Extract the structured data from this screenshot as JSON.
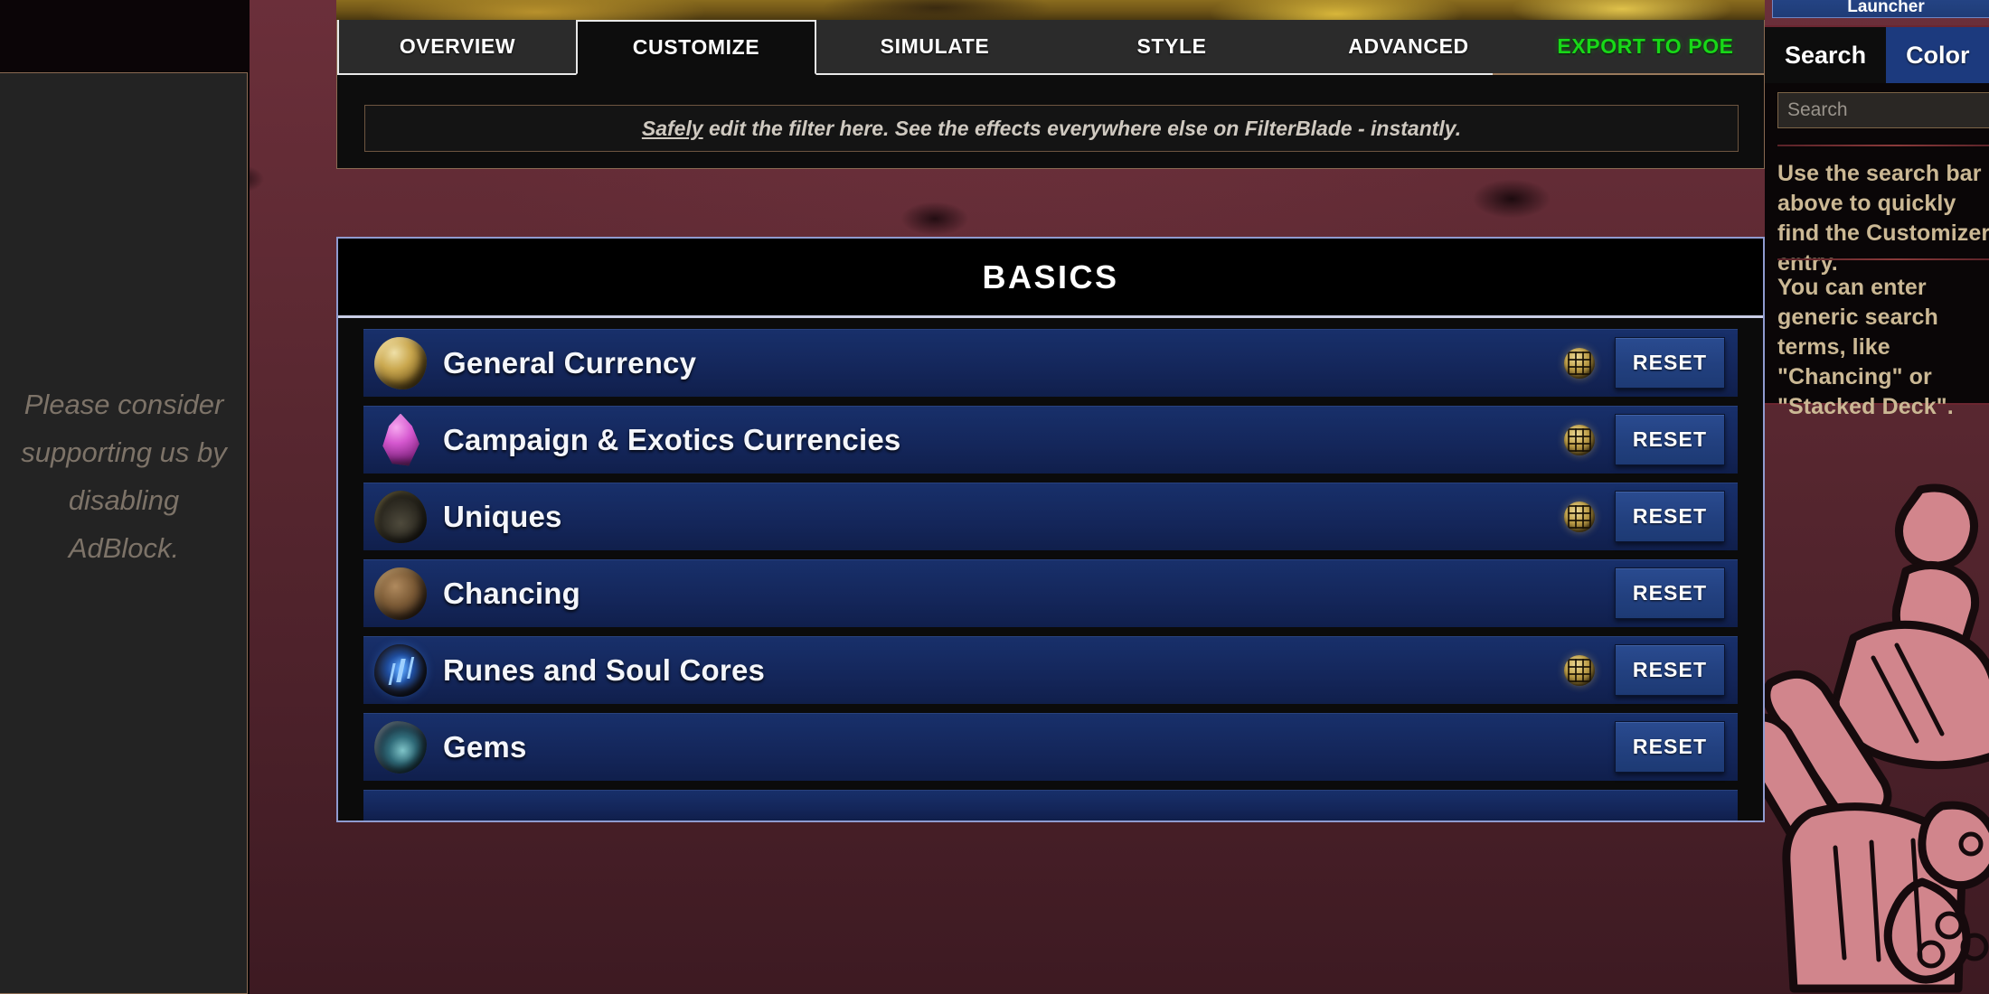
{
  "left_rail": {
    "ad_message": "Please consider supporting us by disabling AdBlock."
  },
  "tabs": [
    {
      "id": "overview",
      "label": "OVERVIEW",
      "active": false
    },
    {
      "id": "customize",
      "label": "CUSTOMIZE",
      "active": true
    },
    {
      "id": "simulate",
      "label": "SIMULATE",
      "active": false
    },
    {
      "id": "style",
      "label": "STYLE",
      "active": false
    },
    {
      "id": "advanced",
      "label": "ADVANCED",
      "active": false
    },
    {
      "id": "export",
      "label": "EXPORT TO POE",
      "active": false
    }
  ],
  "notice": {
    "emphasis": "Safely",
    "rest": " edit the filter here. See the effects everywhere else on FilterBlade - instantly."
  },
  "section": {
    "title": "BASICS",
    "reset_label": "RESET",
    "rows": [
      {
        "label": "General Currency",
        "icon": "currency-shard-icon",
        "icon_style": "ico-gold",
        "has_grid_badge": true
      },
      {
        "label": "Campaign & Exotics Currencies",
        "icon": "magenta-crystal-icon",
        "icon_style": "ico-magenta",
        "has_grid_badge": true
      },
      {
        "label": "Uniques",
        "icon": "beast-head-icon",
        "icon_style": "ico-beast",
        "has_grid_badge": true
      },
      {
        "label": "Chancing",
        "icon": "amulet-icon",
        "icon_style": "ico-amulet",
        "has_grid_badge": false
      },
      {
        "label": "Runes and Soul Cores",
        "icon": "rune-stone-icon",
        "icon_style": "ico-rune",
        "has_grid_badge": true
      },
      {
        "label": "Gems",
        "icon": "gem-geode-icon",
        "icon_style": "ico-gem",
        "has_grid_badge": false
      }
    ]
  },
  "right_rail": {
    "top_button_label": "Launcher",
    "tabs": [
      {
        "label": "Search",
        "active": true
      },
      {
        "label": "Color",
        "active": false
      }
    ],
    "search_placeholder": "Search",
    "search_value": "",
    "help_1": "Use the search bar above to quickly find the Customizer entry.",
    "help_2": "You can enter generic search terms, like \"Chancing\" or \"Stacked Deck\"."
  },
  "colors": {
    "accent_green": "#18d818",
    "row_blue": "#14265a",
    "button_blue": "#22407f",
    "panel_border": "#8f9bd0",
    "sidebar_text": "#cbb894",
    "background_maroon": "#5e2a34"
  }
}
